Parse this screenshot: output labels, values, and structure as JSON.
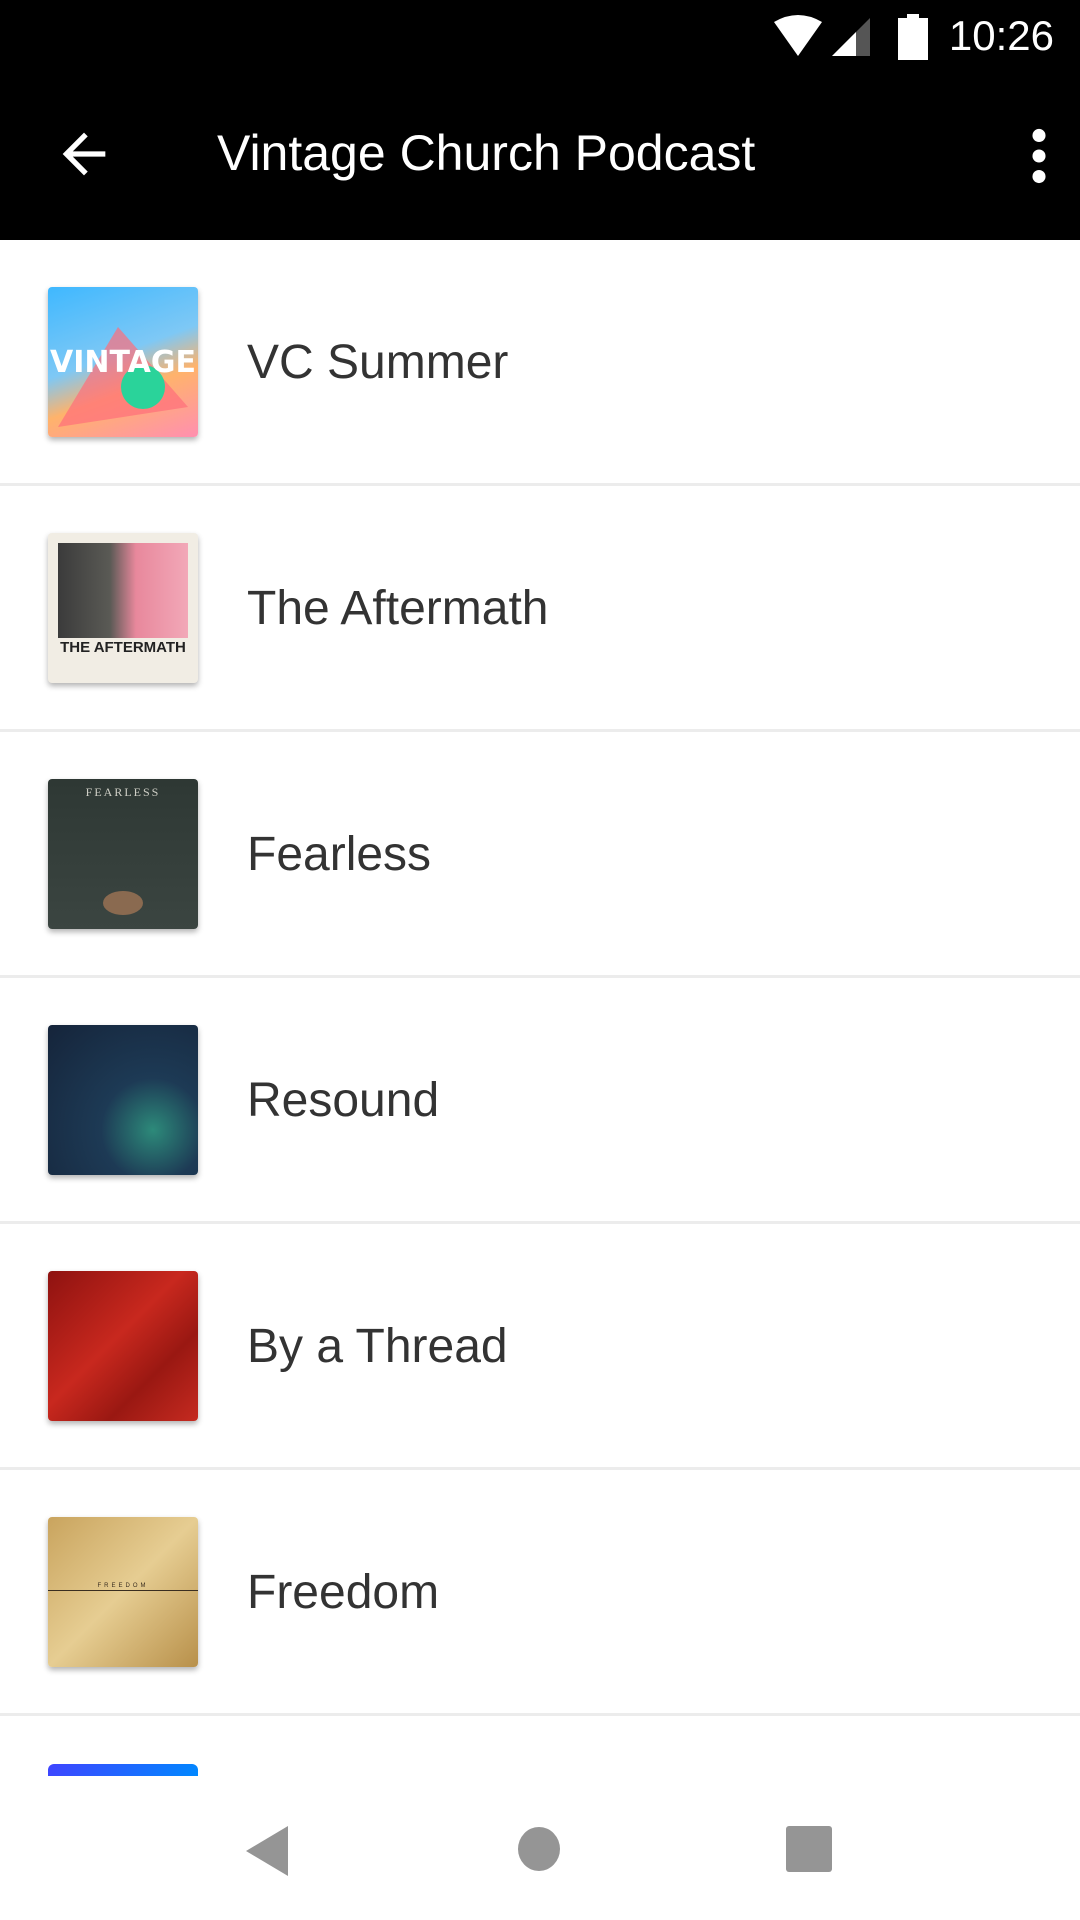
{
  "status_bar": {
    "time": "10:26",
    "icons": [
      "wifi-icon",
      "signal-icon",
      "battery-icon"
    ]
  },
  "app_bar": {
    "title": "Vintage Church Podcast",
    "back_icon": "arrow-back-icon",
    "menu_icon": "more-vert-icon"
  },
  "series": [
    {
      "title": "VC Summer",
      "art_text": "VINTAGE"
    },
    {
      "title": "The Aftermath",
      "art_text": "THE AFTERMATH"
    },
    {
      "title": "Fearless",
      "art_text": "FEARLESS"
    },
    {
      "title": "Resound"
    },
    {
      "title": "By a Thread"
    },
    {
      "title": "Freedom",
      "art_text": "FREEDOM"
    }
  ],
  "nav_bar": {
    "icons": [
      "back-triangle-icon",
      "home-circle-icon",
      "recents-square-icon"
    ]
  }
}
